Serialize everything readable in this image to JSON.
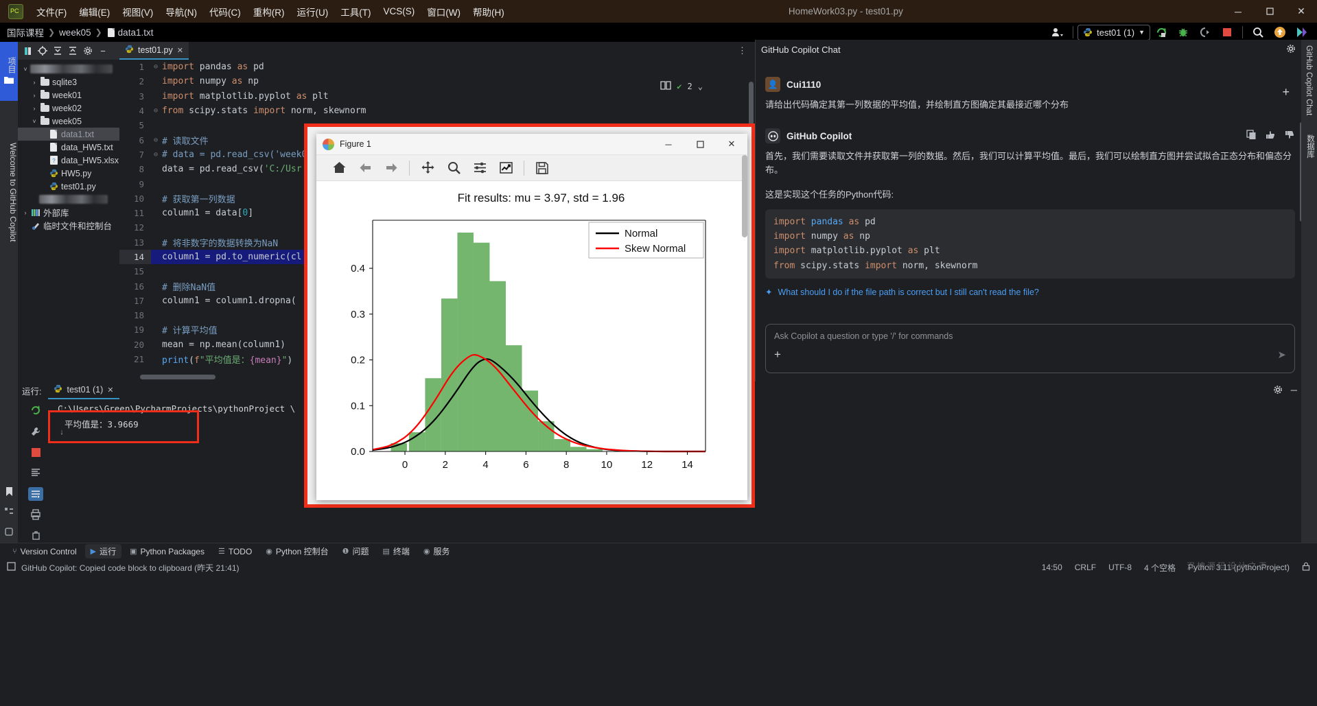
{
  "titlebar": {
    "logo": "pycharm-logo",
    "menus": [
      "文件(F)",
      "编辑(E)",
      "视图(V)",
      "导航(N)",
      "代码(C)",
      "重构(R)",
      "运行(U)",
      "工具(T)",
      "VCS(S)",
      "窗口(W)",
      "帮助(H)"
    ],
    "window_title": "HomeWork03.py - test01.py",
    "minimize": "─",
    "maximize": "☐",
    "close": "✕"
  },
  "navbar": {
    "breadcrumbs": [
      "国际课程",
      "week05",
      "data1.txt"
    ],
    "separator": "❯",
    "account_icon": "user-account-icon",
    "run_config": "test01 (1)",
    "run_icon": "run-icon",
    "debug_icon": "debug-icon",
    "coverage_icon": "coverage-icon",
    "stop_icon": "stop-icon",
    "search_icon": "search-everywhere-icon",
    "update_icon": "update-project-icon",
    "copilot_icon": "copilot-icon"
  },
  "left_strip": {
    "project_tab": "项目",
    "welcome_tab": "Welcome to GitHub Copilot",
    "bottom_icons": [
      "bookmarks-icon",
      "structure-icon",
      "plugins-icon"
    ]
  },
  "project_panel": {
    "toolbar_icons": [
      "select-opened-file-icon",
      "locate-icon",
      "expand-all-icon",
      "collapse-all-icon",
      "settings-icon",
      "hide-icon"
    ],
    "tree": [
      {
        "label": "",
        "redacted": true,
        "indent": 0,
        "arrow": "˅",
        "icon": "folder-icon"
      },
      {
        "label": "sqlite3",
        "indent": 1,
        "arrow": "›",
        "icon": "folder-icon"
      },
      {
        "label": "week01",
        "indent": 1,
        "arrow": "›",
        "icon": "folder-icon"
      },
      {
        "label": "week02",
        "indent": 1,
        "arrow": "›",
        "icon": "folder-icon"
      },
      {
        "label": "week05",
        "indent": 1,
        "arrow": "˅",
        "icon": "folder-icon"
      },
      {
        "label": "data1.txt",
        "indent": 2,
        "arrow": "",
        "icon": "text-file-icon",
        "selected": true
      },
      {
        "label": "data_HW5.txt",
        "indent": 2,
        "arrow": "",
        "icon": "text-file-icon"
      },
      {
        "label": "data_HW5.xlsx",
        "indent": 2,
        "arrow": "",
        "icon": "unknown-file-icon"
      },
      {
        "label": "HW5.py",
        "indent": 2,
        "arrow": "",
        "icon": "python-file-icon"
      },
      {
        "label": "test01.py",
        "indent": 2,
        "arrow": "",
        "icon": "python-file-icon"
      },
      {
        "label": "",
        "redacted": true,
        "indent": 1,
        "arrow": "",
        "icon": ""
      },
      {
        "label": "外部库",
        "indent": 0,
        "arrow": "›",
        "icon": "library-icon"
      },
      {
        "label": "临时文件和控制台",
        "indent": 0,
        "arrow": "",
        "icon": "scratches-icon"
      }
    ]
  },
  "editor": {
    "tab": {
      "label": "test01.py",
      "icon": "python-file-icon",
      "close": "✕"
    },
    "inspections": {
      "count": "2",
      "check_icon": "inspection-check-icon",
      "book_icon": "reader-mode-icon",
      "chevron": "⌄"
    },
    "more_icon": "⋮",
    "highlight_line": 14,
    "lines": [
      {
        "n": 1,
        "fold": "⊖",
        "tokens": [
          {
            "t": "import",
            "c": "kw"
          },
          {
            "t": " pandas ",
            "c": "id"
          },
          {
            "t": "as",
            "c": "kw"
          },
          {
            "t": " pd",
            "c": "id"
          }
        ]
      },
      {
        "n": 2,
        "fold": "",
        "tokens": [
          {
            "t": "import",
            "c": "kw"
          },
          {
            "t": " numpy ",
            "c": "id"
          },
          {
            "t": "as",
            "c": "kw"
          },
          {
            "t": " np",
            "c": "id"
          }
        ]
      },
      {
        "n": 3,
        "fold": "",
        "tokens": [
          {
            "t": "import",
            "c": "kw"
          },
          {
            "t": " matplotlib.pyplot ",
            "c": "id"
          },
          {
            "t": "as",
            "c": "kw"
          },
          {
            "t": " plt",
            "c": "id"
          }
        ]
      },
      {
        "n": 4,
        "fold": "⊖",
        "tokens": [
          {
            "t": "from",
            "c": "kw"
          },
          {
            "t": " scipy.stats ",
            "c": "id"
          },
          {
            "t": "import",
            "c": "kw"
          },
          {
            "t": " norm, skewnorm",
            "c": "id"
          }
        ]
      },
      {
        "n": 5,
        "fold": "",
        "tokens": []
      },
      {
        "n": 6,
        "fold": "⊖",
        "tokens": [
          {
            "t": "# 读取文件",
            "c": "cmt"
          }
        ]
      },
      {
        "n": 7,
        "fold": "⊖",
        "tokens": [
          {
            "t": "# data = pd.read_csv('week0",
            "c": "cmt"
          }
        ]
      },
      {
        "n": 8,
        "fold": "",
        "tokens": [
          {
            "t": "data = pd.read_csv(",
            "c": "id"
          },
          {
            "t": "'C:/Us",
            "c": "str"
          },
          {
            "t": "r",
            "c": "str"
          }
        ]
      },
      {
        "n": 9,
        "fold": "",
        "tokens": []
      },
      {
        "n": 10,
        "fold": "",
        "tokens": [
          {
            "t": "# 获取第一列数据",
            "c": "cmt"
          }
        ]
      },
      {
        "n": 11,
        "fold": "",
        "tokens": [
          {
            "t": "column1 = data[",
            "c": "id"
          },
          {
            "t": "0",
            "c": "num"
          },
          {
            "t": "]",
            "c": "punc"
          }
        ]
      },
      {
        "n": 12,
        "fold": "",
        "tokens": []
      },
      {
        "n": 13,
        "fold": "",
        "tokens": [
          {
            "t": "# 将非数字的数据转换为NaN",
            "c": "cmt"
          }
        ]
      },
      {
        "n": 14,
        "fold": "",
        "tokens": [
          {
            "t": "column1 = pd.to_numeric(c",
            "c": "id"
          },
          {
            "t": "l",
            "c": "id"
          }
        ]
      },
      {
        "n": 15,
        "fold": "",
        "tokens": []
      },
      {
        "n": 16,
        "fold": "",
        "tokens": [
          {
            "t": "# 删除NaN值",
            "c": "cmt"
          }
        ]
      },
      {
        "n": 17,
        "fold": "",
        "tokens": [
          {
            "t": "column1 = column1.dropna(",
            "c": "id"
          }
        ]
      },
      {
        "n": 18,
        "fold": "",
        "tokens": []
      },
      {
        "n": 19,
        "fold": "",
        "tokens": [
          {
            "t": "# 计算平均值",
            "c": "cmt"
          }
        ]
      },
      {
        "n": 20,
        "fold": "",
        "tokens": [
          {
            "t": "mean = np.mean(column1)",
            "c": "id"
          }
        ]
      },
      {
        "n": 21,
        "fold": "",
        "tokens": [
          {
            "t": "print",
            "c": "fn"
          },
          {
            "t": "(",
            "c": "punc"
          },
          {
            "t": "f",
            "c": "fpref"
          },
          {
            "t": "\"平均值是：",
            "c": "str"
          },
          {
            "t": "{mean}",
            "c": "brace"
          },
          {
            "t": "\"",
            "c": "str"
          },
          {
            "t": ")",
            "c": "punc"
          }
        ]
      }
    ]
  },
  "run_window": {
    "label": "运行:",
    "tab": "test01 (1)",
    "tab_icon": "python-run-icon",
    "close": "✕",
    "settings_icon": "settings-icon",
    "hide_icon": "─",
    "sidebar_icons": [
      "rerun-icon",
      "wrench-icon",
      "stop-icon",
      "scroll-icon",
      "soft-wrap-icon",
      "print-icon",
      "trash-icon"
    ],
    "console_lines": [
      "C:\\Users\\Green\\PycharmProjects\\pythonProject \\",
      "平均值是：3.9669"
    ],
    "scroll_up": "↑",
    "scroll_down": "↓"
  },
  "copilot": {
    "title": "GitHub Copilot Chat",
    "settings_icon": "settings-icon",
    "hide_icon": "─",
    "new_chat_icon": "+",
    "user_name": "Cui1110",
    "user_message": "请给出代码确定其第一列数据的平均值，并绘制直方图确定其最接近哪个分布",
    "assistant_name": "GitHub Copilot",
    "assistant_icons": [
      "copy-icon",
      "thumbs-up-icon",
      "thumbs-down-icon"
    ],
    "assistant_text_1": "首先，我们需要读取文件并获取第一列的数据。然后，我们可以计算平均值。最后，我们可以绘制直方图并尝试拟合正态分布和偏态分布。",
    "assistant_text_2": "这是实现这个任务的Python代码:",
    "code_lines": [
      [
        {
          "t": "import",
          "c": "kw"
        },
        {
          "t": " ",
          "c": "id"
        },
        {
          "t": "pandas",
          "c": "fn"
        },
        {
          "t": " ",
          "c": "id"
        },
        {
          "t": "as",
          "c": "kw"
        },
        {
          "t": " pd",
          "c": "id"
        }
      ],
      [
        {
          "t": "import",
          "c": "kw"
        },
        {
          "t": " numpy ",
          "c": "id"
        },
        {
          "t": "as",
          "c": "kw"
        },
        {
          "t": " np",
          "c": "id"
        }
      ],
      [
        {
          "t": "import",
          "c": "kw"
        },
        {
          "t": " matplotlib.pyplot ",
          "c": "id"
        },
        {
          "t": "as",
          "c": "kw"
        },
        {
          "t": " plt",
          "c": "id"
        }
      ],
      [
        {
          "t": "from",
          "c": "kw"
        },
        {
          "t": " scipy.stats ",
          "c": "id"
        },
        {
          "t": "import",
          "c": "kw"
        },
        {
          "t": " norm, skewnorm",
          "c": "id"
        }
      ]
    ],
    "suggestion_icon": "sparkle-icon",
    "suggestion": "What should I do if the file path is correct but I still can't read the file?",
    "input_placeholder": "Ask Copilot a question or type '/' for commands",
    "attach_icon": "+",
    "send_icon": "➤"
  },
  "right_strip": {
    "tabs": [
      "GitHub Copilot Chat",
      "数据库"
    ]
  },
  "figure_window": {
    "title": "Figure 1",
    "icon": "matplotlib-icon",
    "minimize": "─",
    "maximize": "☐",
    "close": "✕",
    "toolbar": [
      "home-icon",
      "back-arrow-icon",
      "forward-arrow-icon",
      "pan-icon",
      "zoom-icon",
      "configure-subplots-icon",
      "axes-edit-icon",
      "save-icon"
    ]
  },
  "chart_data": {
    "type": "bar",
    "title": "Fit results: mu = 3.97,  std = 1.96",
    "xlabel": "",
    "ylabel": "",
    "xlim": [
      -1.6,
      14.9
    ],
    "ylim": [
      0.0,
      0.505
    ],
    "xticks": [
      0,
      2,
      4,
      6,
      8,
      10,
      12,
      14
    ],
    "yticks": [
      0.0,
      0.1,
      0.2,
      0.3,
      0.4
    ],
    "grid": false,
    "legend": {
      "position": "upper right",
      "entries": [
        {
          "name": "Normal",
          "color": "#000000"
        },
        {
          "name": "Skew Normal",
          "color": "#ff0000"
        }
      ]
    },
    "histogram": {
      "color": "#74b66e",
      "bin_centers": [
        -0.3,
        0.6,
        1.4,
        2.2,
        3.0,
        3.8,
        4.6,
        5.4,
        6.2,
        7.0,
        7.8,
        8.6,
        9.4
      ],
      "values": [
        0.018,
        0.042,
        0.16,
        0.334,
        0.478,
        0.456,
        0.372,
        0.232,
        0.133,
        0.066,
        0.027,
        0.01,
        0.005
      ]
    },
    "series": [
      {
        "name": "Normal",
        "color": "#000000",
        "x": [
          -1.6,
          -0.6,
          0.4,
          1.4,
          2.4,
          3.4,
          3.97,
          4.4,
          5.4,
          6.4,
          7.4,
          8.4,
          9.4,
          10.4,
          11.4,
          12.4,
          13.4,
          14.9
        ],
        "y": [
          0.003,
          0.009,
          0.027,
          0.063,
          0.121,
          0.188,
          0.204,
          0.198,
          0.158,
          0.102,
          0.055,
          0.023,
          0.008,
          0.002,
          0.001,
          0.0,
          0.0,
          0.0
        ]
      },
      {
        "name": "Skew Normal",
        "color": "#ff0000",
        "x": [
          -1.6,
          -0.6,
          0.4,
          1.4,
          2.4,
          3.2,
          3.6,
          4.4,
          5.4,
          6.4,
          7.4,
          8.4,
          9.4,
          10.4,
          11.4,
          12.4,
          13.4,
          14.9
        ],
        "y": [
          0.004,
          0.013,
          0.043,
          0.104,
          0.178,
          0.21,
          0.212,
          0.19,
          0.134,
          0.079,
          0.04,
          0.018,
          0.008,
          0.003,
          0.001,
          0.0,
          0.0,
          0.0
        ]
      }
    ]
  },
  "bottom_bar": {
    "items": [
      {
        "label": "Version Control",
        "icon": "branch-icon"
      },
      {
        "label": "运行",
        "icon": "run-icon",
        "active": true
      },
      {
        "label": "Python Packages",
        "icon": "package-icon"
      },
      {
        "label": "TODO",
        "icon": "todo-icon"
      },
      {
        "label": "Python 控制台",
        "icon": "python-console-icon"
      },
      {
        "label": "问题",
        "icon": "problems-icon"
      },
      {
        "label": "终端",
        "icon": "terminal-icon"
      },
      {
        "label": "服务",
        "icon": "services-icon"
      }
    ]
  },
  "status_bar": {
    "icon": "event-log-icon",
    "message": "GitHub Copilot: Copied code block to clipboard (昨天 21:41)",
    "time": "14:50",
    "line_sep": "CRLF",
    "encoding": "UTF-8",
    "indent": "4 个空格",
    "interpreter": "Python 3.11 (pythonProject)",
    "watermark": "汉坤源码设计之天"
  }
}
